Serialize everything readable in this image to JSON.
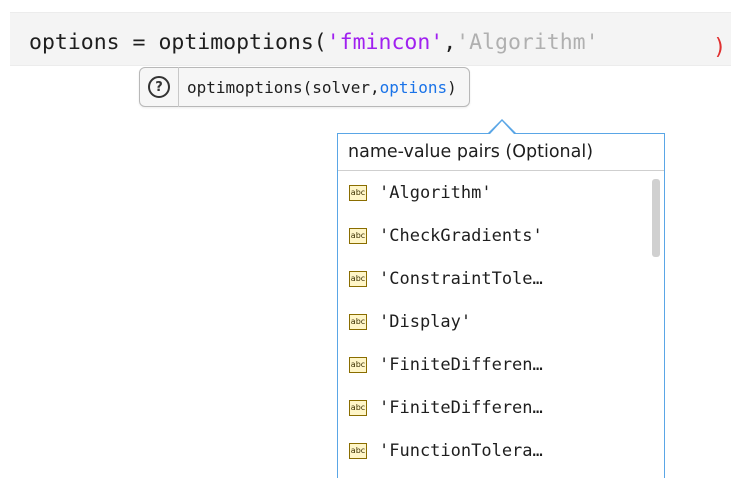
{
  "editor": {
    "code_prefix": "options = optimoptions(",
    "arg1": "'fmincon'",
    "comma": ",",
    "arg2": "'Algorithm'",
    "trail": ")"
  },
  "signature_hint": {
    "icon": "help-icon",
    "text_prefix": "optimoptions(solver,",
    "highlighted_param": "options",
    "text_suffix": ")"
  },
  "completion_popup": {
    "header": "name-value pairs (Optional)",
    "item_icon": "abc-string-icon",
    "items": [
      "'Algorithm'",
      "'CheckGradients'",
      "'ConstraintTole…",
      "'Display'",
      "'FiniteDifferen…",
      "'FiniteDifferen…",
      "'FunctionTolera…"
    ]
  },
  "colors": {
    "string_literal": "#a020f0",
    "ghost_text": "#b0b0b0",
    "active_param": "#1a73e8",
    "popup_border": "#5aa6e6",
    "error_squiggle": "#e03030"
  }
}
